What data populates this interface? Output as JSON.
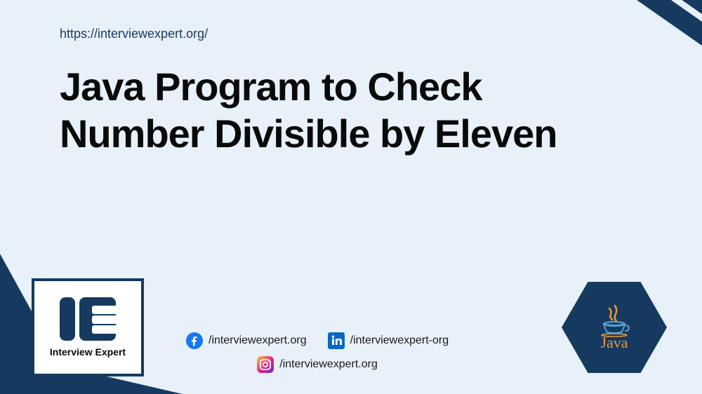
{
  "url": "https://interviewexpert.org/",
  "title": "Java Program to Check Number Divisible by Eleven",
  "logo": {
    "text": "Interview Expert"
  },
  "socials": {
    "facebook": "/interviewexpert.org",
    "linkedin": "/interviewexpert-org",
    "instagram": "/interviewexpert.org"
  },
  "java_label": "Java"
}
